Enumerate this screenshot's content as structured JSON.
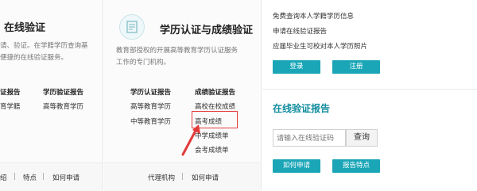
{
  "left": {
    "title": "在线验证",
    "desc_lines": [
      "请、验证。在学籍学历查询基",
      "便捷的在线验证服务。"
    ],
    "col1_head": "证报告",
    "col1_link": "育学籍",
    "col2_head": "学历验证报告",
    "col2_link": "高等教育学历",
    "footer_link1": "绍",
    "footer_link2": "特点",
    "footer_link3": "如何申请",
    "sep": "|"
  },
  "middle": {
    "title": "学历认证与成绩验证",
    "desc_lines": [
      "教育部授权的开展高等教育学历认证服务",
      "工作的专门机构。"
    ],
    "col1_head": "学历认证报告",
    "col1_links": [
      "高等教育学历",
      "中等教育学历"
    ],
    "col2_head": "成绩验证报告",
    "col2_links": [
      "高校在校成绩",
      "高考成绩",
      "中学成绩单",
      "会考成绩单"
    ],
    "footer_link1": "代理机构",
    "footer_link2": "如何申请",
    "sep": "|"
  },
  "right": {
    "links": [
      "免费查询本人学籍学历信息",
      "申请在线验证报告",
      "应届毕业生可校对本人学历照片"
    ],
    "login_label": "登录",
    "register_label": "注册",
    "section_title": "在线验证报告",
    "search_placeholder": "请输入在线验证码",
    "search_button": "查询",
    "how_apply_label": "如何申请",
    "report_features_label": "报告特点"
  },
  "colors": {
    "accent": "#1aa6b7",
    "section_title": "#138ea0",
    "highlight": "#e23b3b"
  }
}
